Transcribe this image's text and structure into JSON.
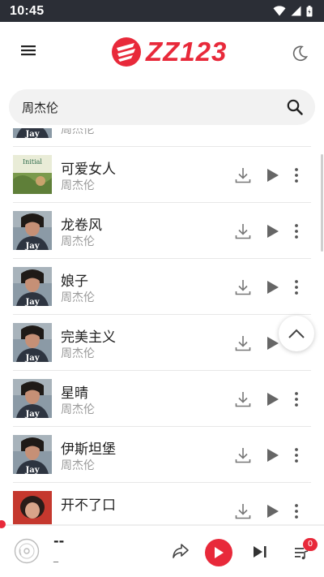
{
  "status_bar": {
    "time": "10:45"
  },
  "header": {
    "logo_text": "ZZ123",
    "brand_color": "#e8293a"
  },
  "search": {
    "query": "周杰伦"
  },
  "songs": [
    {
      "title": "",
      "artist": "周杰伦",
      "cover": "jay"
    },
    {
      "title": "可爱女人",
      "artist": "周杰伦",
      "cover": "initial"
    },
    {
      "title": "龙卷风",
      "artist": "周杰伦",
      "cover": "jay"
    },
    {
      "title": "娘子",
      "artist": "周杰伦",
      "cover": "jay"
    },
    {
      "title": "完美主义",
      "artist": "周杰伦",
      "cover": "jay"
    },
    {
      "title": "星晴",
      "artist": "周杰伦",
      "cover": "jay"
    },
    {
      "title": "伊斯坦堡",
      "artist": "周杰伦",
      "cover": "jay"
    },
    {
      "title": "开不了口",
      "artist": "",
      "cover": "red"
    }
  ],
  "cover_labels": {
    "jay": "Jay",
    "initial": "Initial"
  },
  "player": {
    "title": "--",
    "artist": "_",
    "queue_count": "0",
    "progress": 0
  },
  "icons": {
    "menu": "hamburger-icon",
    "theme": "moon-icon",
    "search": "search-icon",
    "download": "download-icon",
    "play": "play-icon",
    "more": "more-vertical-icon",
    "scroll_top": "chevron-up-icon",
    "share": "share-icon",
    "next": "skip-next-icon",
    "queue": "playlist-icon"
  }
}
